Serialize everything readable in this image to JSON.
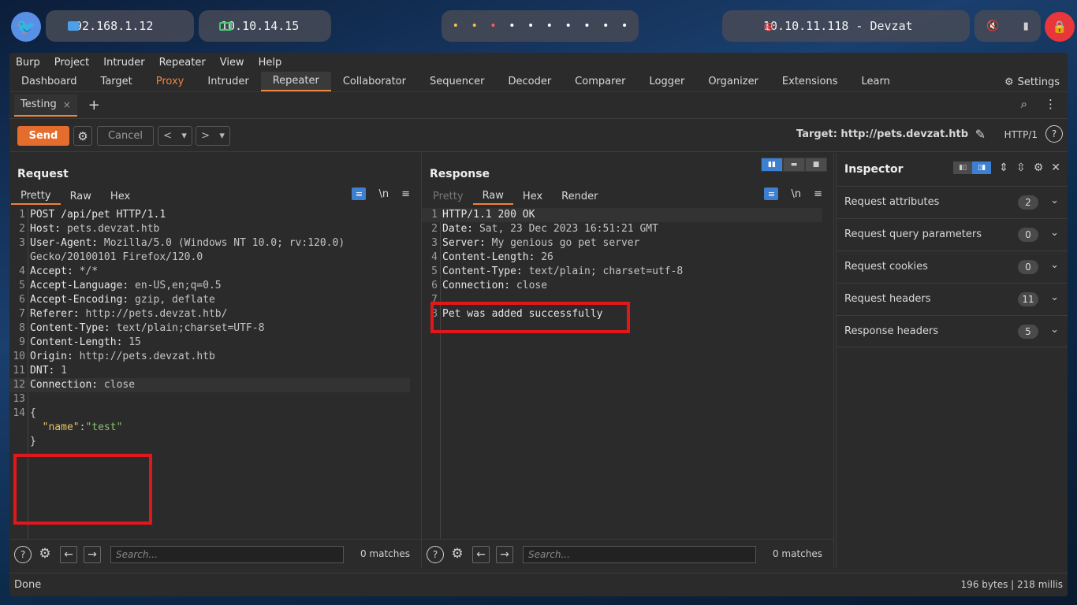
{
  "system": {
    "ip_local": "192.168.1.12",
    "ip_vpn": "10.10.14.15",
    "dots": [
      "•",
      "•",
      "•",
      "•",
      "•",
      "•",
      "•",
      "•",
      "•",
      "•"
    ],
    "target_machine": "10.10.11.118 - Devzat",
    "colors": {
      "vpn": "#48c774",
      "target": "#ff4d4d",
      "lock": "#e8363a"
    }
  },
  "menu": [
    "Burp",
    "Project",
    "Intruder",
    "Repeater",
    "View",
    "Help"
  ],
  "main_tabs": [
    "Dashboard",
    "Target",
    "Proxy",
    "Intruder",
    "Repeater",
    "Collaborator",
    "Sequencer",
    "Decoder",
    "Comparer",
    "Logger",
    "Organizer",
    "Extensions",
    "Learn"
  ],
  "settings_label": "Settings",
  "repeater_tab": {
    "label": "Testing",
    "close": "×"
  },
  "toolbar": {
    "send": "Send",
    "cancel": "Cancel",
    "target_label": "Target: http://pets.devzat.htb",
    "protocol": "HTTP/1"
  },
  "request": {
    "title": "Request",
    "tabs": [
      "Pretty",
      "Raw",
      "Hex"
    ],
    "lines": [
      {
        "n": "1",
        "k": "POST /api/pet HTTP/1.1",
        "v": ""
      },
      {
        "n": "2",
        "k": "Host:",
        "v": " pets.devzat.htb"
      },
      {
        "n": "3",
        "k": "User-Agent:",
        "v": " Mozilla/5.0 (Windows NT 10.0; rv:120.0)"
      },
      {
        "n": "",
        "k": "",
        "v": "Gecko/20100101 Firefox/120.0"
      },
      {
        "n": "4",
        "k": "Accept:",
        "v": " */*"
      },
      {
        "n": "5",
        "k": "Accept-Language:",
        "v": " en-US,en;q=0.5"
      },
      {
        "n": "6",
        "k": "Accept-Encoding:",
        "v": " gzip, deflate"
      },
      {
        "n": "7",
        "k": "Referer:",
        "v": " http://pets.devzat.htb/"
      },
      {
        "n": "8",
        "k": "Content-Type:",
        "v": " text/plain;charset=UTF-8"
      },
      {
        "n": "9",
        "k": "Content-Length:",
        "v": " 15"
      },
      {
        "n": "10",
        "k": "Origin:",
        "v": " http://pets.devzat.htb"
      },
      {
        "n": "11",
        "k": "DNT:",
        "v": " 1"
      },
      {
        "n": "12",
        "k": "Connection:",
        "v": " close"
      },
      {
        "n": "13",
        "k": "",
        "v": ""
      }
    ],
    "body_line_no": "14",
    "body_open": "{",
    "body_key": "\"name\"",
    "body_colon": ":",
    "body_value": "\"test\"",
    "body_close": "}",
    "search_placeholder": "Search...",
    "matches": "0 matches"
  },
  "response": {
    "title": "Response",
    "tabs": [
      "Pretty",
      "Raw",
      "Hex",
      "Render"
    ],
    "lines": [
      {
        "n": "1",
        "k": "HTTP/1.1 200 OK",
        "v": ""
      },
      {
        "n": "2",
        "k": "Date:",
        "v": " Sat, 23 Dec 2023 16:51:21 GMT"
      },
      {
        "n": "3",
        "k": "Server:",
        "v": " My genious go pet server"
      },
      {
        "n": "4",
        "k": "Content-Length:",
        "v": " 26"
      },
      {
        "n": "5",
        "k": "Content-Type:",
        "v": " text/plain; charset=utf-8"
      },
      {
        "n": "6",
        "k": "Connection:",
        "v": " close"
      },
      {
        "n": "7",
        "k": "",
        "v": ""
      },
      {
        "n": "8",
        "k": "Pet was added successfully",
        "v": ""
      }
    ],
    "search_placeholder": "Search...",
    "matches": "0 matches"
  },
  "inspector": {
    "title": "Inspector",
    "rows": [
      {
        "label": "Request attributes",
        "count": "2"
      },
      {
        "label": "Request query parameters",
        "count": "0"
      },
      {
        "label": "Request cookies",
        "count": "0"
      },
      {
        "label": "Request headers",
        "count": "11"
      },
      {
        "label": "Response headers",
        "count": "5"
      }
    ]
  },
  "status": {
    "left": "Done",
    "right": "196 bytes | 218 millis"
  },
  "accent_color": "#ef8340",
  "highlight_color": "#e0171b"
}
